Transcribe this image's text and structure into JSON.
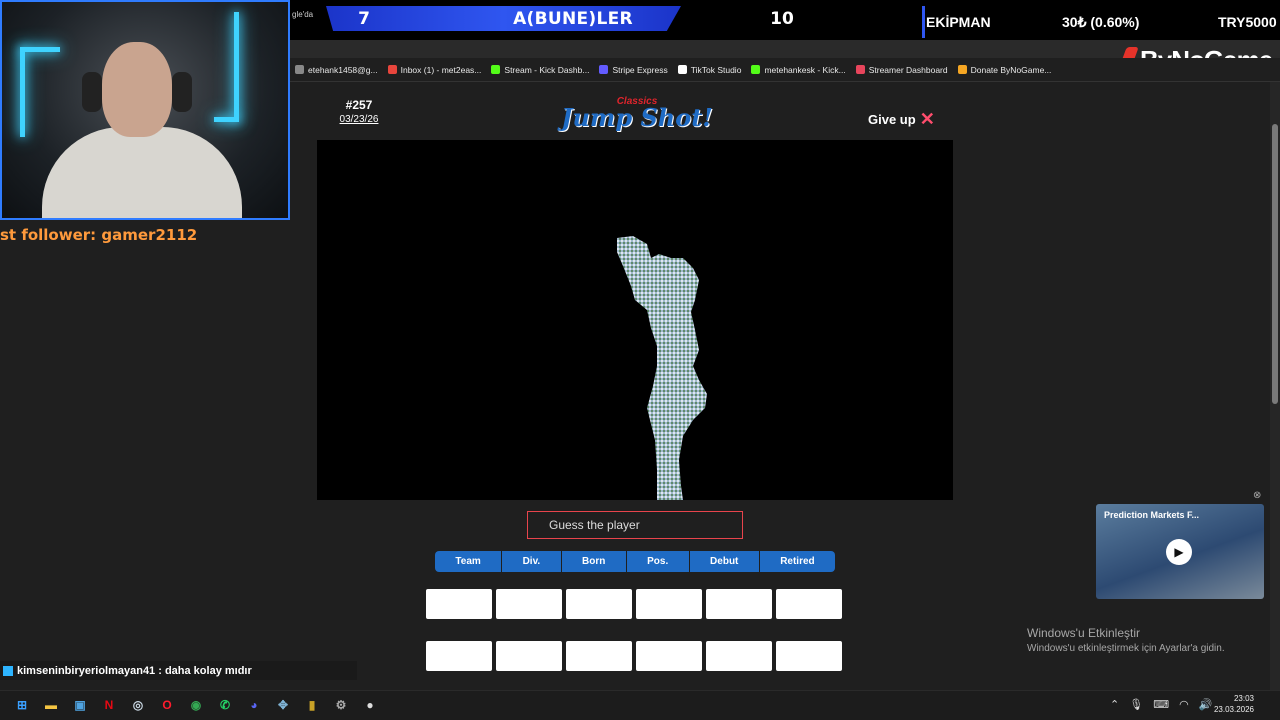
{
  "overlay": {
    "tab_snippet": "gle'da",
    "score_left": "7",
    "team_name": "A(BUNE)LER",
    "score_right": "10",
    "equipment_label": "EKİPMAN",
    "equipment_price": "30₺ (0.60%)",
    "equipment_goal": "TRY5000"
  },
  "brand": {
    "name": "ByNoGame"
  },
  "bookmarks": [
    {
      "label": "etehank1458@g...",
      "icon": "mail-icon",
      "color": "#888888"
    },
    {
      "label": "Inbox (1) - met2eas...",
      "icon": "gmail-icon",
      "color": "#e8453c"
    },
    {
      "label": "Stream - Kick Dashb...",
      "icon": "kick-icon",
      "color": "#53fc18"
    },
    {
      "label": "Stripe Express",
      "icon": "stripe-icon",
      "color": "#635bff"
    },
    {
      "label": "TikTok Studio",
      "icon": "tiktok-icon",
      "color": "#ffffff"
    },
    {
      "label": "metehankesk - Kick...",
      "icon": "kick-icon",
      "color": "#53fc18"
    },
    {
      "label": "Streamer Dashboard",
      "icon": "dashboard-icon",
      "color": "#e8455c"
    },
    {
      "label": "Donate ByNoGame...",
      "icon": "donate-icon",
      "color": "#f5a623"
    }
  ],
  "stream": {
    "follower_text": "st follower: gamer2112",
    "chat_message": "kimseninbiryeriolmayan41 : daha kolay mıdır"
  },
  "game": {
    "puzzle_number": "#257",
    "puzzle_date": "03/23/26",
    "logo_subtitle": "Classics",
    "logo_title": "Jump Shot!",
    "give_up_label": "Give up",
    "guess_placeholder": "Guess the player",
    "categories": [
      "Team",
      "Div.",
      "Born",
      "Pos.",
      "Debut",
      "Retired"
    ]
  },
  "ad": {
    "title": "Prediction Markets F..."
  },
  "watermark": {
    "title": "Windows'u Etkinleştir",
    "subtitle": "Windows'u etkinleştirmek için Ayarlar'a gidin."
  },
  "taskbar": {
    "time": "23:03",
    "date": "23.03.2026"
  },
  "colors": {
    "accent_blue": "#1f6bc4",
    "guess_border": "#e8444c",
    "follower_orange": "#ff9a3c",
    "neon_cyan": "#3fd3ff"
  }
}
